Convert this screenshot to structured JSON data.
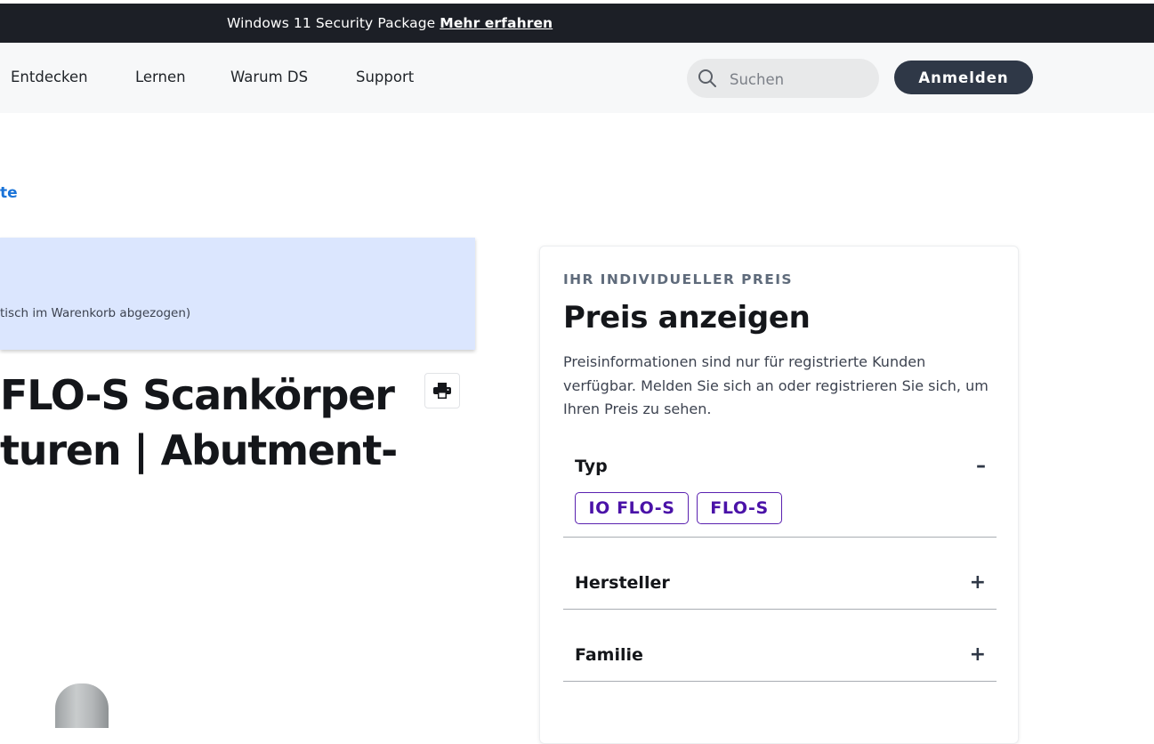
{
  "banner": {
    "message": "Windows 11 Security Package",
    "link": "Mehr erfahren"
  },
  "nav": {
    "items": [
      "Entdecken",
      "Lernen",
      "Warum DS",
      "Support"
    ],
    "search_placeholder": "Suchen",
    "login": "Anmelden"
  },
  "breadcrumb": {
    "back_text": "te"
  },
  "promo": {
    "text": "tisch im Warenkorb abgezogen)"
  },
  "product": {
    "title_line1": "FLO-S Scankörper",
    "title_line2": "turen | Abutment-"
  },
  "price_card": {
    "eyebrow": "IHR INDIVIDUELLER PREIS",
    "title": "Preis anzeigen",
    "description": "Preisinformationen sind nur für registrierte Kunden verfügbar. Melden Sie sich an oder registrieren Sie sich, um Ihren Preis zu sehen.",
    "accordions": [
      {
        "label": "Typ",
        "toggle": "–",
        "expanded": true,
        "options": [
          "IO FLO-S",
          "FLO-S"
        ]
      },
      {
        "label": "Hersteller",
        "toggle": "+",
        "expanded": false
      },
      {
        "label": "Familie",
        "toggle": "+",
        "expanded": false
      }
    ]
  },
  "colors": {
    "banner_bg": "#1c1f26",
    "nav_bg": "#f7f8f9",
    "button_dark": "#2f3847",
    "link_blue": "#1a73d8",
    "promo_bg": "#dbe6fe",
    "chip_purple": "#4a12a8"
  }
}
